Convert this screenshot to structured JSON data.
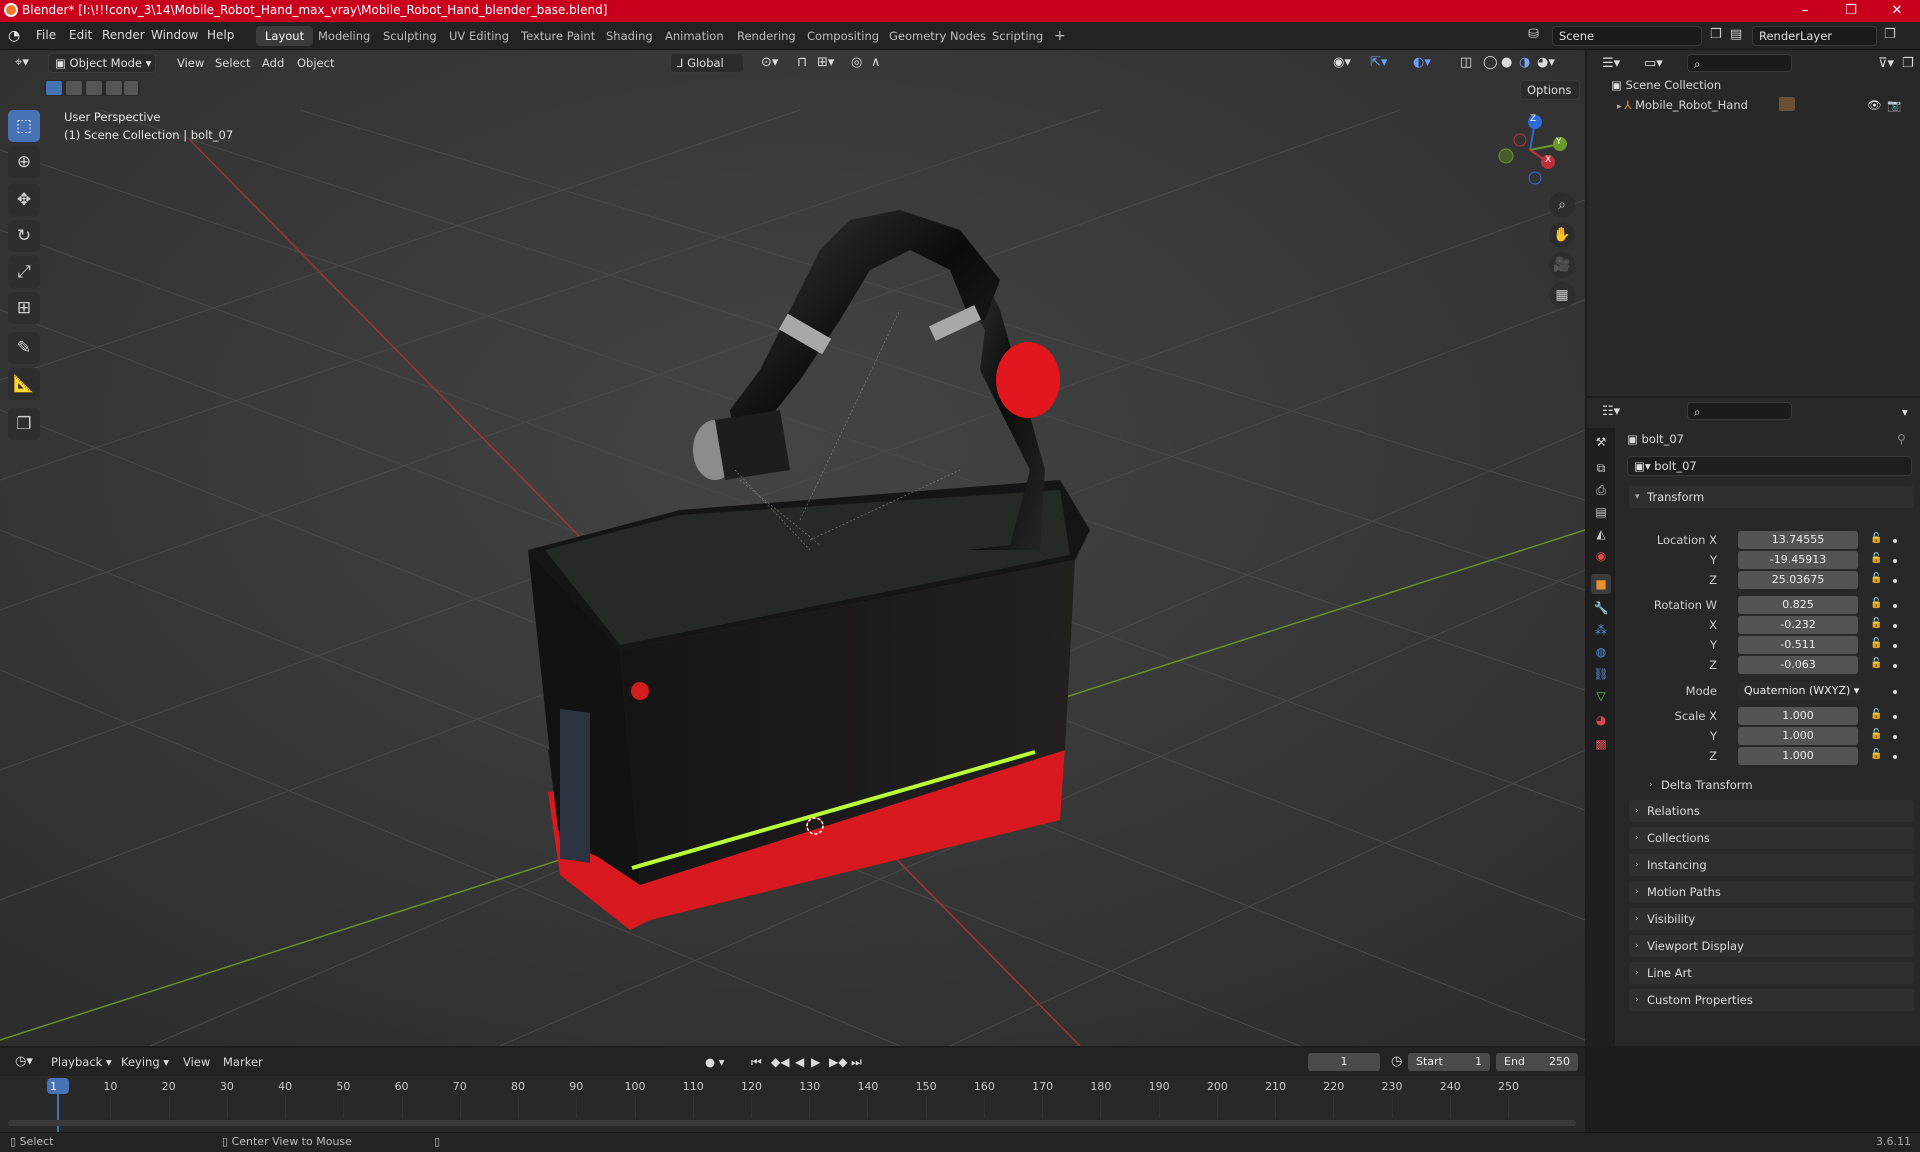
{
  "window": {
    "title": "Blender* [I:\\!!!conv_3\\14\\Mobile_Robot_Hand_max_vray\\Mobile_Robot_Hand_blender_base.blend]",
    "minimize": "–",
    "maximize": "❐",
    "close": "✕"
  },
  "menu": {
    "items": [
      "File",
      "Edit",
      "Render",
      "Window",
      "Help"
    ]
  },
  "workspaces": [
    "Layout",
    "Modeling",
    "Sculpting",
    "UV Editing",
    "Texture Paint",
    "Shading",
    "Animation",
    "Rendering",
    "Compositing",
    "Geometry Nodes",
    "Scripting"
  ],
  "workspace_add": "+",
  "scene": {
    "name": "Scene",
    "view_layer": "RenderLayer"
  },
  "viewport": {
    "mode": "Object Mode",
    "menus": [
      "View",
      "Select",
      "Add",
      "Object"
    ],
    "orientation": "Global",
    "options": "Options",
    "overlay_title": "User Perspective",
    "overlay_subtitle": "(1) Scene Collection | bolt_07",
    "gizmo": {
      "z": "Z",
      "y": "Y",
      "x": "X"
    }
  },
  "outliner": {
    "root": "Scene Collection",
    "item": "Mobile_Robot_Hand"
  },
  "properties": {
    "object_name": "bolt_07",
    "data_name": "bolt_07",
    "transform_label": "Transform",
    "location_label": "Location X",
    "location": {
      "x": "13.74555",
      "y": "-19.45913",
      "z": "25.03675"
    },
    "rotation_label": "Rotation W",
    "rotation": {
      "w": "0.825",
      "x": "-0.232",
      "y": "-0.511",
      "z": "-0.063"
    },
    "mode_label": "Mode",
    "mode": "Quaternion (WXYZ)",
    "scale_label": "Scale X",
    "scale": {
      "x": "1.000",
      "y": "1.000",
      "z": "1.000"
    },
    "axis": {
      "x": "X",
      "y": "Y",
      "z": "Z"
    },
    "delta": "Delta Transform",
    "panels": [
      "Relations",
      "Collections",
      "Instancing",
      "Motion Paths",
      "Visibility",
      "Viewport Display",
      "Line Art",
      "Custom Properties"
    ]
  },
  "timeline": {
    "menus": [
      "Playback",
      "Keying",
      "View",
      "Marker"
    ],
    "current_frame": "1",
    "start_label": "Start",
    "start": "1",
    "end_label": "End",
    "end": "250",
    "ticks": [
      "1",
      "10",
      "20",
      "30",
      "40",
      "50",
      "60",
      "70",
      "80",
      "90",
      "100",
      "110",
      "120",
      "130",
      "140",
      "150",
      "160",
      "170",
      "180",
      "190",
      "200",
      "210",
      "220",
      "230",
      "240",
      "250"
    ]
  },
  "status": {
    "left": "Select",
    "middle": "Center View to Mouse",
    "version": "3.6.11"
  }
}
